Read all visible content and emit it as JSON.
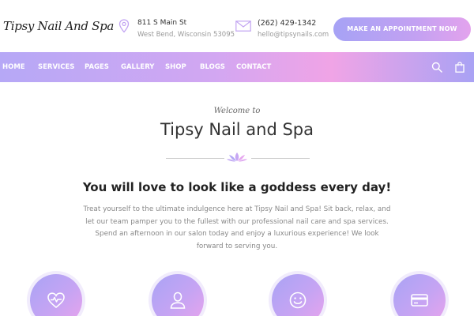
{
  "header": {
    "logo": "Tipsy Nail And Spa",
    "address_line1": "811 S Main St",
    "address_line2": "West Bend, Wisconsin 53095",
    "phone": "(262) 429-1342",
    "email": "hello@tipsynails.com",
    "cta_label": "MAKE AN APPOINTMENT NOW"
  },
  "nav": {
    "items": [
      "HOME",
      "SERVICES",
      "PAGES",
      "GALLERY",
      "SHOP",
      "BLOGS",
      "CONTACT"
    ]
  },
  "main": {
    "welcome": "Welcome to",
    "title": "Tipsy Nail and Spa",
    "tagline": "You will love to look like a goddess every day!",
    "paragraph": "Treat yourself to the ultimate indulgence here at Tipsy Nail and Spa! Sit back, relax, and let our team pamper you to the fullest with our professional nail care and spa services. Spend an afternoon in our salon today and enjoy a luxurious experience! We look forward to serving you."
  },
  "features": [
    {
      "icon": "heart-pulse-icon"
    },
    {
      "icon": "user-icon"
    },
    {
      "icon": "smile-icon"
    },
    {
      "icon": "credit-card-icon"
    }
  ],
  "colors": {
    "accent_start": "#a6a2f5",
    "accent_end": "#eaa3ec"
  }
}
